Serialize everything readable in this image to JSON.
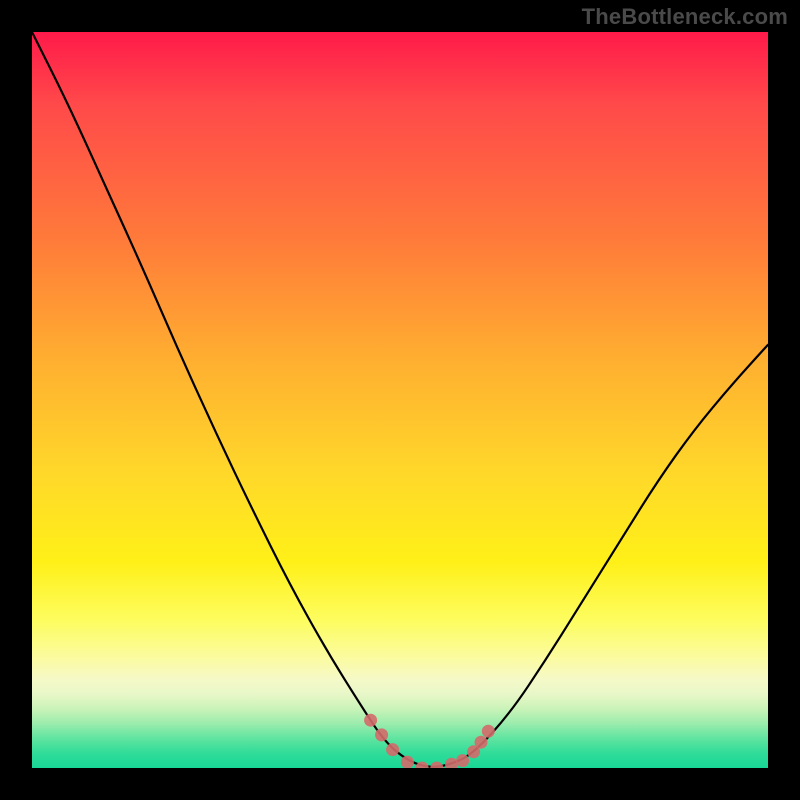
{
  "watermark": "TheBottleneck.com",
  "chart_data": {
    "type": "line",
    "title": "",
    "xlabel": "",
    "ylabel": "",
    "xlim": [
      0,
      1
    ],
    "ylim": [
      0,
      1
    ],
    "note": "Axes are unlabeled; values are normalized 0–1 in plot coordinates. Single V-shaped curve over a vertical color gradient (red top → green bottom).",
    "series": [
      {
        "name": "curve",
        "x": [
          0.0,
          0.05,
          0.1,
          0.15,
          0.2,
          0.25,
          0.3,
          0.35,
          0.4,
          0.45,
          0.48,
          0.51,
          0.54,
          0.57,
          0.6,
          0.65,
          0.7,
          0.75,
          0.8,
          0.85,
          0.9,
          0.95,
          1.0
        ],
        "y": [
          1.0,
          0.9,
          0.79,
          0.68,
          0.565,
          0.455,
          0.35,
          0.25,
          0.16,
          0.08,
          0.035,
          0.01,
          0.0,
          0.005,
          0.02,
          0.075,
          0.15,
          0.23,
          0.31,
          0.39,
          0.46,
          0.52,
          0.575
        ]
      }
    ],
    "markers": {
      "name": "highlight-dots",
      "color": "#d46a6a",
      "x": [
        0.46,
        0.475,
        0.49,
        0.51,
        0.53,
        0.55,
        0.57,
        0.585,
        0.6,
        0.61,
        0.62
      ],
      "y": [
        0.065,
        0.045,
        0.025,
        0.008,
        0.0,
        0.0,
        0.005,
        0.01,
        0.022,
        0.035,
        0.05
      ]
    },
    "gradient_stops": [
      {
        "pos": 0.0,
        "color": "#ff1a4a"
      },
      {
        "pos": 0.1,
        "color": "#ff4a4a"
      },
      {
        "pos": 0.28,
        "color": "#ff7a3a"
      },
      {
        "pos": 0.45,
        "color": "#ffb030"
      },
      {
        "pos": 0.6,
        "color": "#ffd82a"
      },
      {
        "pos": 0.72,
        "color": "#fff018"
      },
      {
        "pos": 0.8,
        "color": "#fdfd60"
      },
      {
        "pos": 0.85,
        "color": "#fbfba0"
      },
      {
        "pos": 0.88,
        "color": "#f5f9c8"
      },
      {
        "pos": 0.9,
        "color": "#e8f7c8"
      },
      {
        "pos": 0.92,
        "color": "#c9f3b8"
      },
      {
        "pos": 0.94,
        "color": "#9aecad"
      },
      {
        "pos": 0.96,
        "color": "#5fe4a0"
      },
      {
        "pos": 0.98,
        "color": "#30dc99"
      },
      {
        "pos": 1.0,
        "color": "#18d696"
      }
    ]
  }
}
